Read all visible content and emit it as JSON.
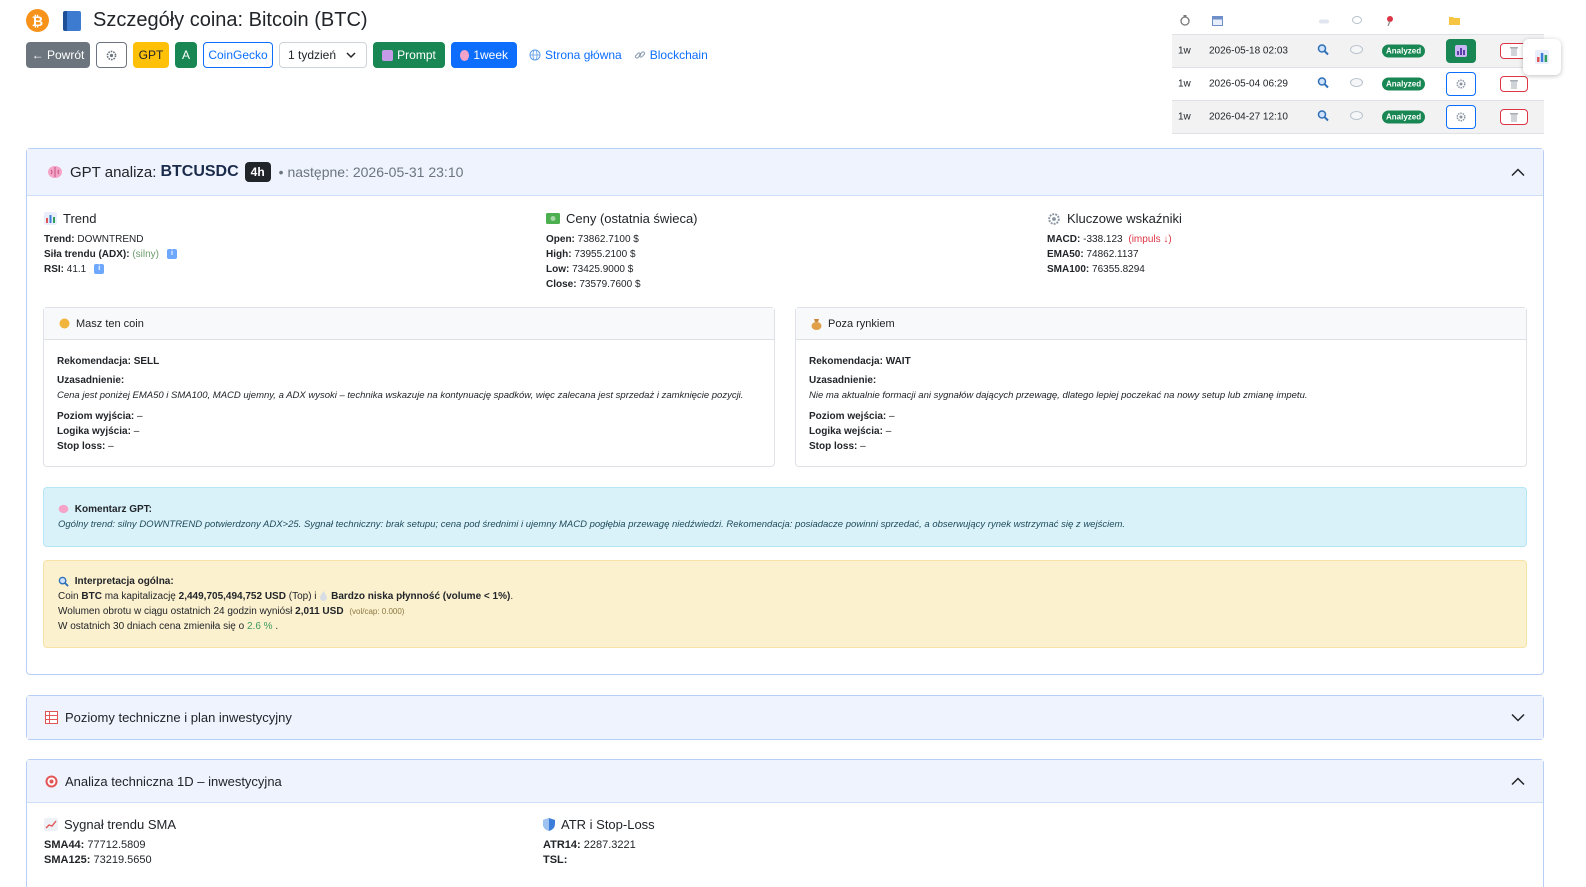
{
  "header": {
    "title": "Szczegóły coina: Bitcoin (BTC)",
    "coin_symbol": "₿"
  },
  "toolbar": {
    "back": "← Powrót",
    "gpt": "GPT",
    "a": "A",
    "coingecko": "CoinGecko",
    "period_select": "1 tydzień",
    "prompt": "Prompt",
    "week": "1week",
    "home_link": "Strona główna",
    "blockchain_link": "Blockchain"
  },
  "history": {
    "rows": [
      {
        "tf": "1w",
        "date": "2026-05-18 02:03",
        "status": "Analyzed"
      },
      {
        "tf": "1w",
        "date": "2026-05-04 06:29",
        "status": "Analyzed"
      },
      {
        "tf": "1w",
        "date": "2026-04-27 12:10",
        "status": "Analyzed"
      }
    ]
  },
  "gpt": {
    "title_prefix": "GPT analiza:",
    "symbol": "BTCUSDC",
    "timeframe": "4h",
    "next": "• następne: 2026-05-31 23:10",
    "trend": {
      "title": "Trend",
      "trend_label": "Trend:",
      "trend_value": "DOWNTREND",
      "adx_label": "Siła trendu (ADX):",
      "adx_value": "(silny)",
      "rsi_label": "RSI:",
      "rsi_value": "41.1"
    },
    "prices": {
      "title": "Ceny (ostatnia świeca)",
      "open_label": "Open:",
      "open": "73862.7100 $",
      "high_label": "High:",
      "high": "73955.2100 $",
      "low_label": "Low:",
      "low": "73425.9000 $",
      "close_label": "Close:",
      "close": "73579.7600 $"
    },
    "indicators": {
      "title": "Kluczowe wskaźniki",
      "macd_label": "MACD:",
      "macd": "-338.123",
      "macd_note": "(impuls ↓)",
      "ema50_label": "EMA50:",
      "ema50": "74862.1137",
      "sma100_label": "SMA100:",
      "sma100": "76355.8294"
    },
    "have_coin": {
      "title": "Masz ten coin",
      "rec_label": "Rekomendacja:",
      "rec": "SELL",
      "just_label": "Uzasadnienie:",
      "just": "Cena jest poniżej EMA50 i SMA100, MACD ujemny, a ADX wysoki – technika wskazuje na kontynuację spadków, więc zalecana jest sprzedaż i zamknięcie pozycji.",
      "l1_label": "Poziom wyjścia:",
      "l1": "–",
      "l2_label": "Logika wyjścia:",
      "l2": "–",
      "l3_label": "Stop loss:",
      "l3": "–"
    },
    "outside": {
      "title": "Poza rynkiem",
      "rec_label": "Rekomendacja:",
      "rec": "WAIT",
      "just_label": "Uzasadnienie:",
      "just": "Nie ma aktualnie formacji ani sygnałów dających przewagę, dlatego lepiej poczekać na nowy setup lub zmianę impetu.",
      "l1_label": "Poziom wejścia:",
      "l1": "–",
      "l2_label": "Logika wejścia:",
      "l2": "–",
      "l3_label": "Stop loss:",
      "l3": "–"
    },
    "comment": {
      "title": "Komentarz GPT:",
      "text": "Ogólny trend: silny DOWNTREND potwierdzony ADX>25. Sygnał techniczny: brak setupu; cena pod średnimi i ujemny MACD pogłębia przewagę niedźwiedzi. Rekomendacja: posiadacze powinni sprzedać, a obserwujący rynek wstrzymać się z wejściem."
    },
    "interpretation": {
      "title": "Interpretacja ogólna:",
      "l1_a": "Coin",
      "l1_sym": "BTC",
      "l1_b": "ma kapitalizację",
      "l1_cap": "2,449,705,494,752 USD",
      "l1_c": "(Top) i",
      "l1_liq": "Bardzo niska płynność (volume < 1%)",
      "l1_d": ".",
      "l2_a": "Wolumen obrotu w ciągu ostatnich 24 godzin wyniósł",
      "l2_vol": "2,011 USD",
      "l2_note": "(vol/cap: 0.000)",
      "l3_a": "W ostatnich 30 dniach cena zmieniła się o",
      "l3_pct": "2.6 %",
      "l3_b": "."
    }
  },
  "levels": {
    "title": "Poziomy techniczne i plan inwestycyjny"
  },
  "tech": {
    "title": "Analiza techniczna 1D – inwestycyjna",
    "sma": {
      "title": "Sygnał trendu SMA",
      "sma44_label": "SMA44:",
      "sma44": "77712.5809",
      "sma125_label": "SMA125:",
      "sma125": "73219.5650"
    },
    "atr": {
      "title": "ATR i Stop-Loss",
      "atr_label": "ATR14:",
      "atr": "2287.3221",
      "tsl_label": "TSL:"
    }
  },
  "colors": {
    "primary": "#0d6efd",
    "success": "#198754",
    "warning": "#ffc107",
    "danger": "#dc3545",
    "bitcoin": "#f7931a"
  }
}
